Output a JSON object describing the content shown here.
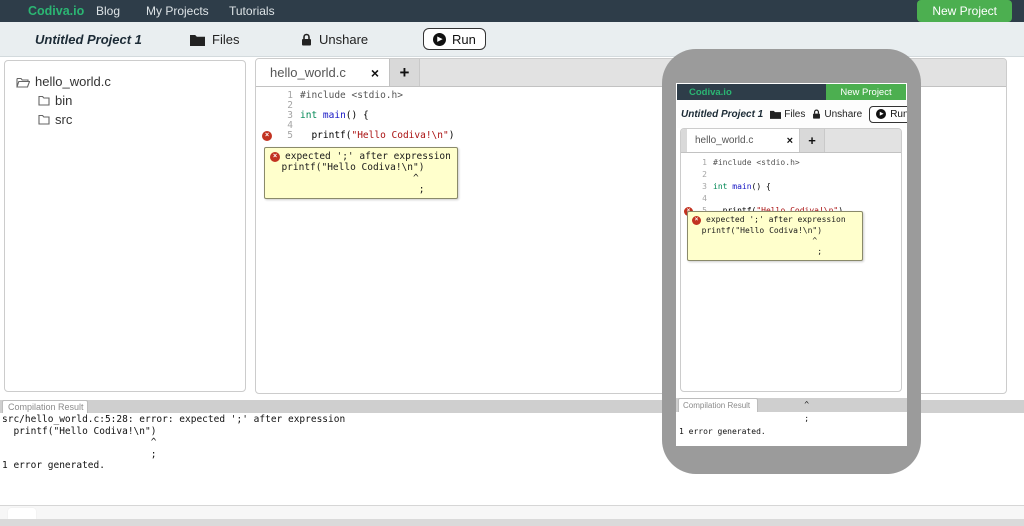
{
  "colors": {
    "navbar_bg": "#2e3d49",
    "brand": "#2bb673",
    "new_project": "#4caf50",
    "toolbar_bg": "#e9eef0",
    "panel_border": "#cccccc",
    "tabbar_bg": "#d9d9d9",
    "tooltip_bg": "#ffffcc",
    "error": "#c23321",
    "phone_body": "#9b9b9b",
    "code_meta": "#555555",
    "code_type": "#008855",
    "code_def": "#1515c4",
    "code_string": "#aa1111"
  },
  "navbar": {
    "brand": "Codiva.io",
    "items": [
      "Blog",
      "My Projects",
      "Tutorials"
    ],
    "new_project": "New Project"
  },
  "toolbar": {
    "project_title": "Untitled Project 1",
    "files": "Files",
    "unshare": "Unshare",
    "run": "Run",
    "play_glyph": "▶"
  },
  "file_tree": {
    "root": "hello_world.c",
    "children": [
      "bin",
      "src"
    ]
  },
  "editor": {
    "tab": "hello_world.c",
    "close_glyph": "×",
    "add_tab_glyph": "+",
    "error_glyph": "×",
    "lines": [
      {
        "no": "1",
        "error": false,
        "segments": [
          {
            "t": "#include <stdio.h>",
            "c": "meta"
          }
        ]
      },
      {
        "no": "2",
        "error": false,
        "segments": []
      },
      {
        "no": "3",
        "error": false,
        "segments": [
          {
            "t": "int",
            "c": "type"
          },
          {
            "t": " ",
            "c": "plain"
          },
          {
            "t": "main",
            "c": "def"
          },
          {
            "t": "() {",
            "c": "plain"
          }
        ]
      },
      {
        "no": "4",
        "error": false,
        "segments": []
      },
      {
        "no": "5",
        "error": true,
        "segments": [
          {
            "t": "  printf(",
            "c": "plain"
          },
          {
            "t": "\"Hello Codiva!\\n\"",
            "c": "string"
          },
          {
            "t": ")",
            "c": "plain"
          }
        ]
      }
    ],
    "tooltip": {
      "title": "expected ';' after expression",
      "body_lines": [
        "  printf(\"Hello Codiva!\\n\")",
        "                         ^",
        "                          ;"
      ]
    }
  },
  "compilation": {
    "tab": "Compilation Result",
    "lines": [
      "src/hello_world.c:5:28: error: expected ';' after expression",
      "  printf(\"Hello Codiva!\\n\")",
      "                          ^",
      "                          ;",
      "1 error generated."
    ]
  }
}
